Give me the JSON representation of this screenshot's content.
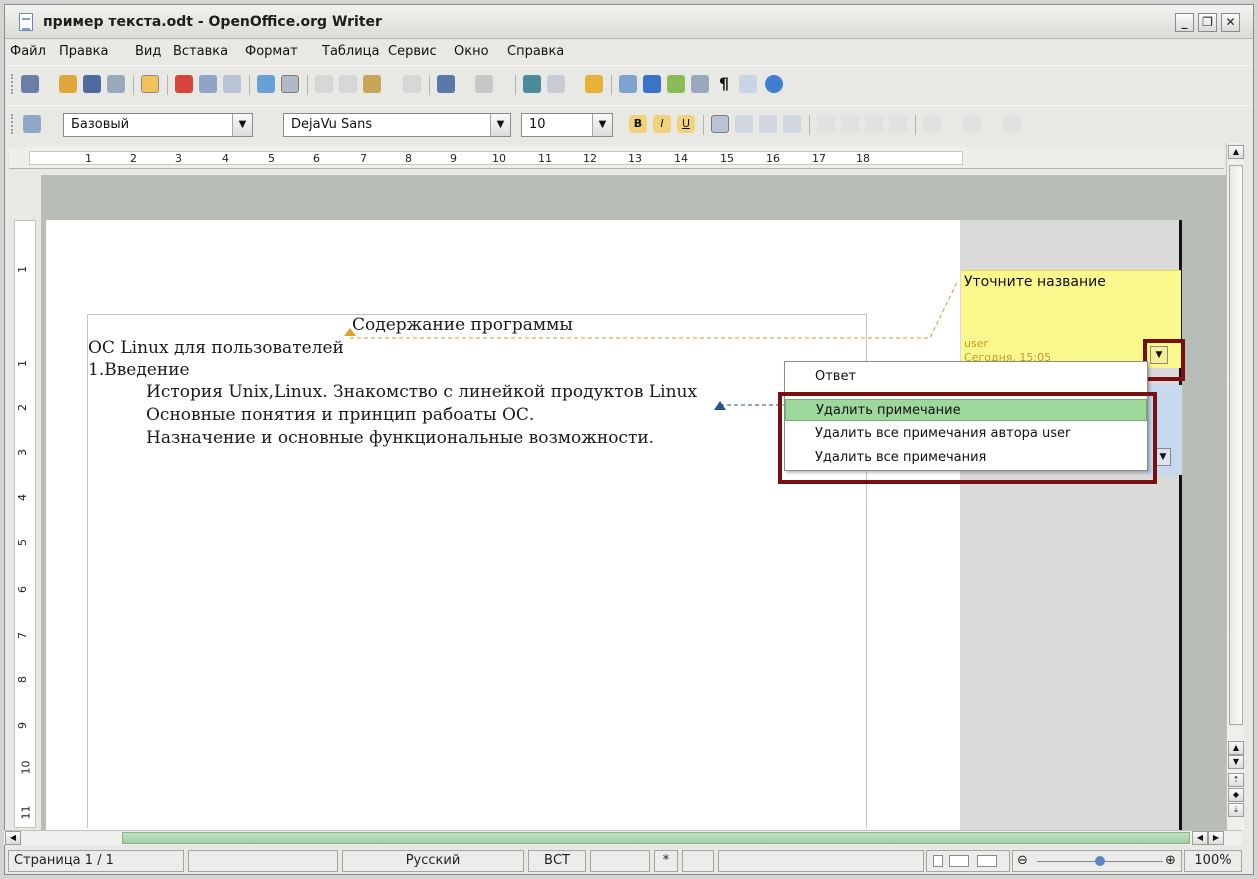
{
  "window": {
    "title": "пример текста.odt - OpenOffice.org Writer",
    "minimize": "_",
    "maximize": "❐",
    "close": "✕"
  },
  "menu": [
    "Файл",
    "Правка",
    "Вид",
    "Вставка",
    "Формат",
    "Таблица",
    "Сервис",
    "Окно",
    "Справка"
  ],
  "formatting": {
    "style": "Базовый",
    "font": "DejaVu Sans",
    "size": "10"
  },
  "ruler": {
    "h_ticks": [
      "1",
      "2",
      "3",
      "4",
      "5",
      "6",
      "7",
      "8",
      "9",
      "10",
      "11",
      "12",
      "13",
      "14",
      "15",
      "16",
      "17",
      "18"
    ],
    "v_ticks": [
      "1",
      "1",
      "2",
      "3",
      "4",
      "5",
      "6",
      "7",
      "8",
      "9",
      "10",
      "11"
    ]
  },
  "document": {
    "heading": "Содержание программы",
    "line1": "ОС Linux для пользователей",
    "line2": "1.Введение",
    "line3": "История Unix,Linux. Знакомство с линейкой продуктов Linux",
    "line4": "Основные понятия и принцип рабоаты ОС.",
    "line5": "Назначение и основные функциональные возможности."
  },
  "comment": {
    "text": "Уточните название",
    "author": "user",
    "date": "Сегодня, 15:05"
  },
  "context_menu": {
    "reply": "Ответ",
    "delete": "Удалить примечание",
    "delete_author": "Удалить все примечания автора user",
    "delete_all": "Удалить все примечания"
  },
  "statusbar": {
    "page": "Страница 1 / 1",
    "language": "Русский",
    "mode": "ВСТ",
    "modified": "*",
    "zoom": "100%"
  }
}
